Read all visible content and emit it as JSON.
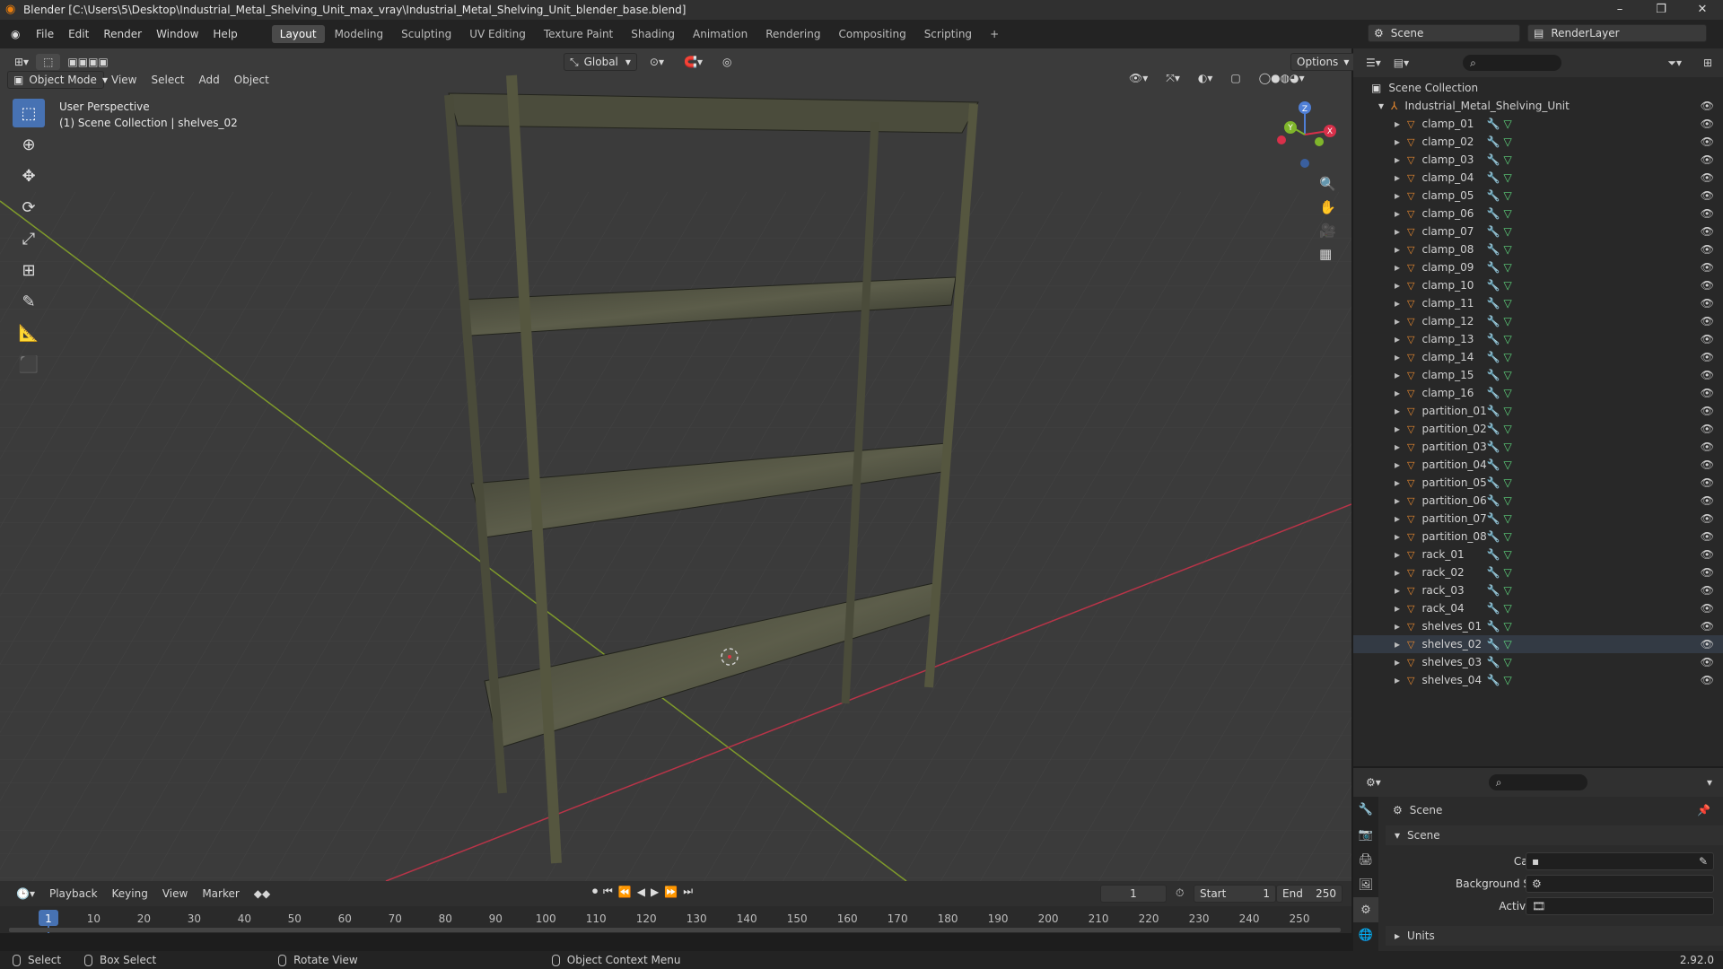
{
  "window": {
    "title": "Blender [C:\\Users\\5\\Desktop\\Industrial_Metal_Shelving_Unit_max_vray\\Industrial_Metal_Shelving_Unit_blender_base.blend]"
  },
  "menu": [
    "File",
    "Edit",
    "Render",
    "Window",
    "Help"
  ],
  "workspaces": [
    {
      "label": "Layout",
      "active": true
    },
    {
      "label": "Modeling"
    },
    {
      "label": "Sculpting"
    },
    {
      "label": "UV Editing"
    },
    {
      "label": "Texture Paint"
    },
    {
      "label": "Shading"
    },
    {
      "label": "Animation"
    },
    {
      "label": "Rendering"
    },
    {
      "label": "Compositing"
    },
    {
      "label": "Scripting"
    }
  ],
  "scene_selector": {
    "scene": "Scene",
    "view_layer": "RenderLayer"
  },
  "viewport": {
    "transform_orientation": "Global",
    "options_label": "Options",
    "mode": "Object Mode",
    "header_menus": [
      "View",
      "Select",
      "Add",
      "Object"
    ],
    "perspective_label": "User Perspective",
    "collection_label": "(1) Scene Collection | shelves_02",
    "gizmo_axes": {
      "x": "X",
      "y": "Y",
      "z": "Z"
    }
  },
  "outliner": {
    "root": "Scene Collection",
    "collection": "Industrial_Metal_Shelving_Unit",
    "objects": [
      "clamp_01",
      "clamp_02",
      "clamp_03",
      "clamp_04",
      "clamp_05",
      "clamp_06",
      "clamp_07",
      "clamp_08",
      "clamp_09",
      "clamp_10",
      "clamp_11",
      "clamp_12",
      "clamp_13",
      "clamp_14",
      "clamp_15",
      "clamp_16",
      "partition_01",
      "partition_02",
      "partition_03",
      "partition_04",
      "partition_05",
      "partition_06",
      "partition_07",
      "partition_08",
      "rack_01",
      "rack_02",
      "rack_03",
      "rack_04",
      "shelves_01",
      "shelves_02",
      "shelves_03",
      "shelves_04"
    ],
    "active_object": "shelves_02"
  },
  "properties": {
    "context": "Scene",
    "panel": "Scene",
    "fields": [
      {
        "label": "Camera"
      },
      {
        "label": "Background Scene"
      },
      {
        "label": "Active Clip"
      }
    ],
    "subpanel": "Units"
  },
  "timeline": {
    "menus": [
      "Playback",
      "Keying",
      "View",
      "Marker"
    ],
    "current_frame": "1",
    "start_label": "Start",
    "start": "1",
    "end_label": "End",
    "end": "250",
    "ticks": [
      "1",
      "10",
      "20",
      "30",
      "40",
      "50",
      "60",
      "70",
      "80",
      "90",
      "100",
      "110",
      "120",
      "130",
      "140",
      "150",
      "160",
      "170",
      "180",
      "190",
      "200",
      "210",
      "220",
      "230",
      "240",
      "250"
    ],
    "tick_frames": [
      1,
      10,
      20,
      30,
      40,
      50,
      60,
      70,
      80,
      90,
      100,
      110,
      120,
      130,
      140,
      150,
      160,
      170,
      180,
      190,
      200,
      210,
      220,
      230,
      240,
      250
    ]
  },
  "statusbar": {
    "select": "Select",
    "box_select": "Box Select",
    "rotate": "Rotate View",
    "context_menu": "Object Context Menu",
    "version": "2.92.0"
  },
  "colors": {
    "accent": "#4772b3",
    "object_icon": "#e8892f",
    "modifier_icon": "#6e9cd6",
    "mesh_icon": "#5fd67e",
    "axis_x": "#d8304a",
    "axis_y": "#7fb52b"
  }
}
